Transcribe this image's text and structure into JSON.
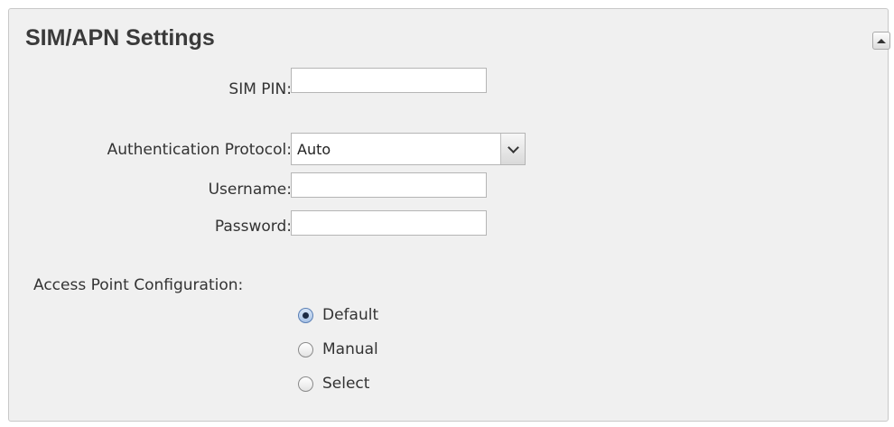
{
  "panel": {
    "title": "SIM/APN Settings",
    "collapse_icon": "triangle-up-icon"
  },
  "fields": {
    "sim_pin": {
      "label": "SIM PIN:",
      "value": ""
    },
    "auth_protocol": {
      "label": "Authentication Protocol:",
      "selected": "Auto"
    },
    "username": {
      "label": "Username:",
      "value": ""
    },
    "password": {
      "label": "Password:",
      "value": ""
    }
  },
  "access_point": {
    "label": "Access Point Configuration:",
    "options": [
      {
        "label": "Default",
        "checked": true
      },
      {
        "label": "Manual",
        "checked": false
      },
      {
        "label": "Select",
        "checked": false
      }
    ]
  },
  "colors": {
    "panel_bg": "#f0f0f0",
    "border": "#c8c8c8",
    "text": "#333333",
    "radio_checked": "#a9c3e6"
  }
}
